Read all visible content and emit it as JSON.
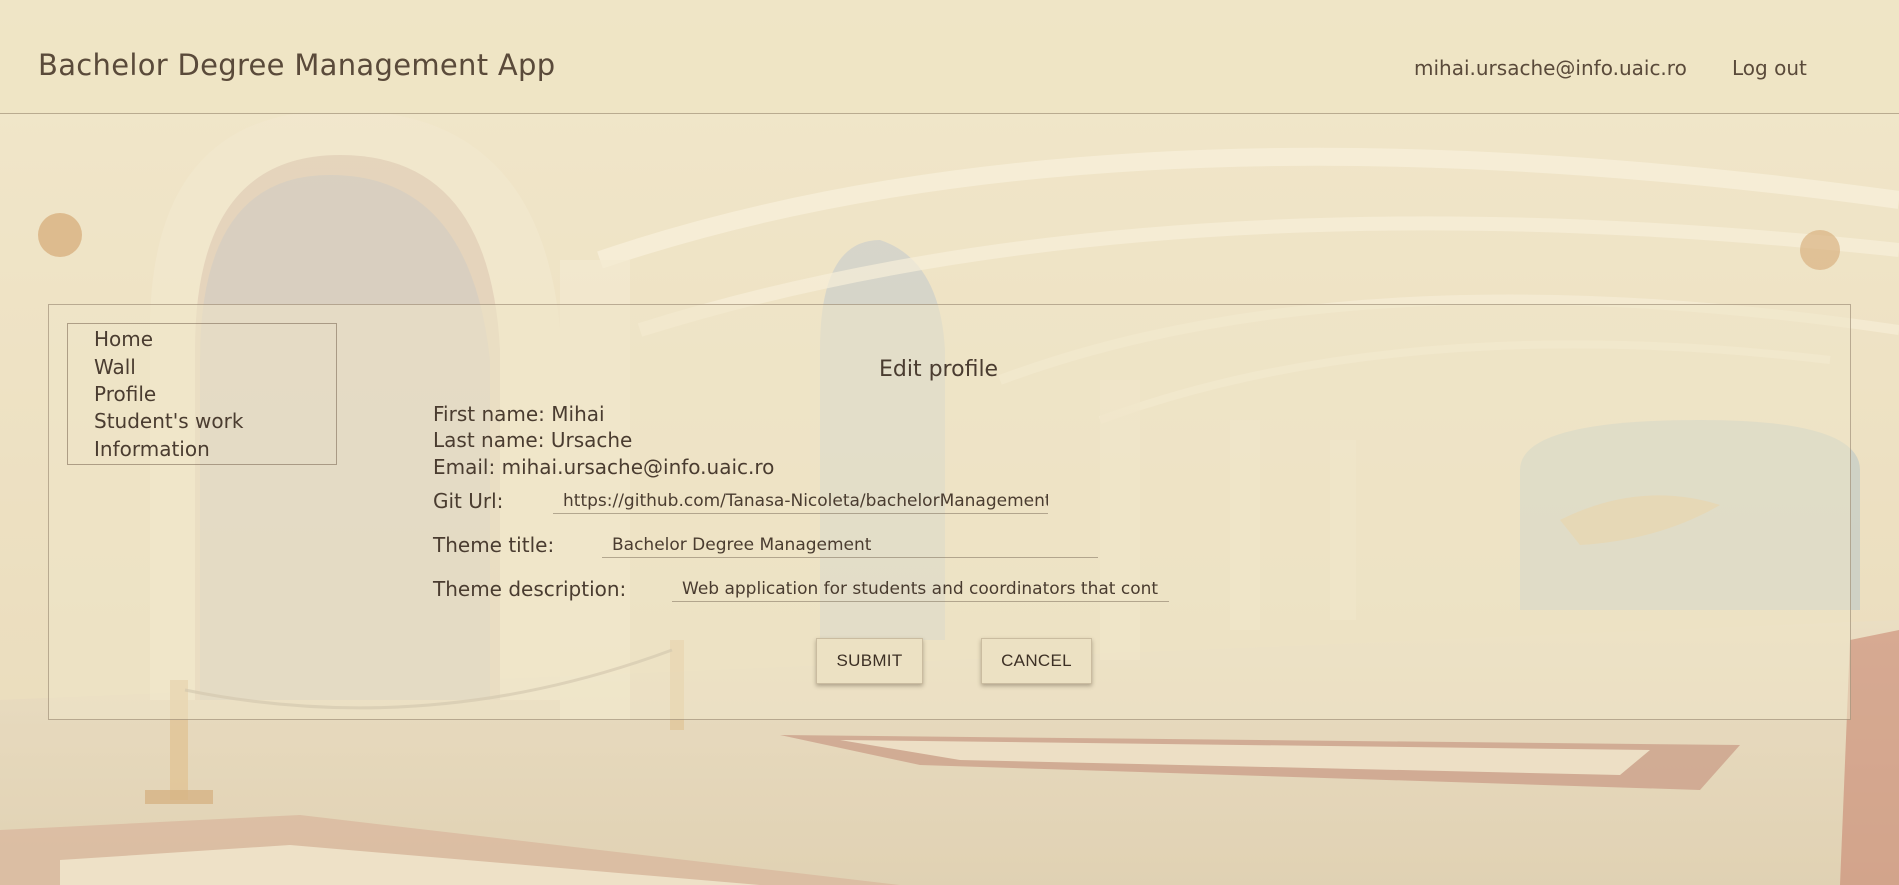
{
  "header": {
    "app_title": "Bachelor Degree Management App",
    "user_email": "mihai.ursache@info.uaic.ro",
    "logout_label": "Log out"
  },
  "sidebar": {
    "items": [
      {
        "label": "Home"
      },
      {
        "label": "Wall"
      },
      {
        "label": "Profile"
      },
      {
        "label": "Student's work"
      },
      {
        "label": "Information"
      }
    ]
  },
  "form": {
    "title": "Edit profile",
    "first_name": "First name: Mihai",
    "last_name": "Last name: Ursache",
    "email": "Email: mihai.ursache@info.uaic.ro",
    "git_url_label": "Git Url:",
    "git_url_value": "https://github.com/Tanasa-Nicoleta/bachelorManagement",
    "theme_title_label": "Theme title:",
    "theme_title_value": "Bachelor Degree Management",
    "theme_description_label": "Theme description:",
    "theme_description_value": "Web application for students and coordinators that cont",
    "submit_label": "SUBMIT",
    "cancel_label": "CANCEL"
  },
  "colors": {
    "text": "#4a3c30",
    "header_bg": "#eee4c4",
    "panel_bg": "#eee6c8",
    "button_bg": "#ece1c3"
  }
}
